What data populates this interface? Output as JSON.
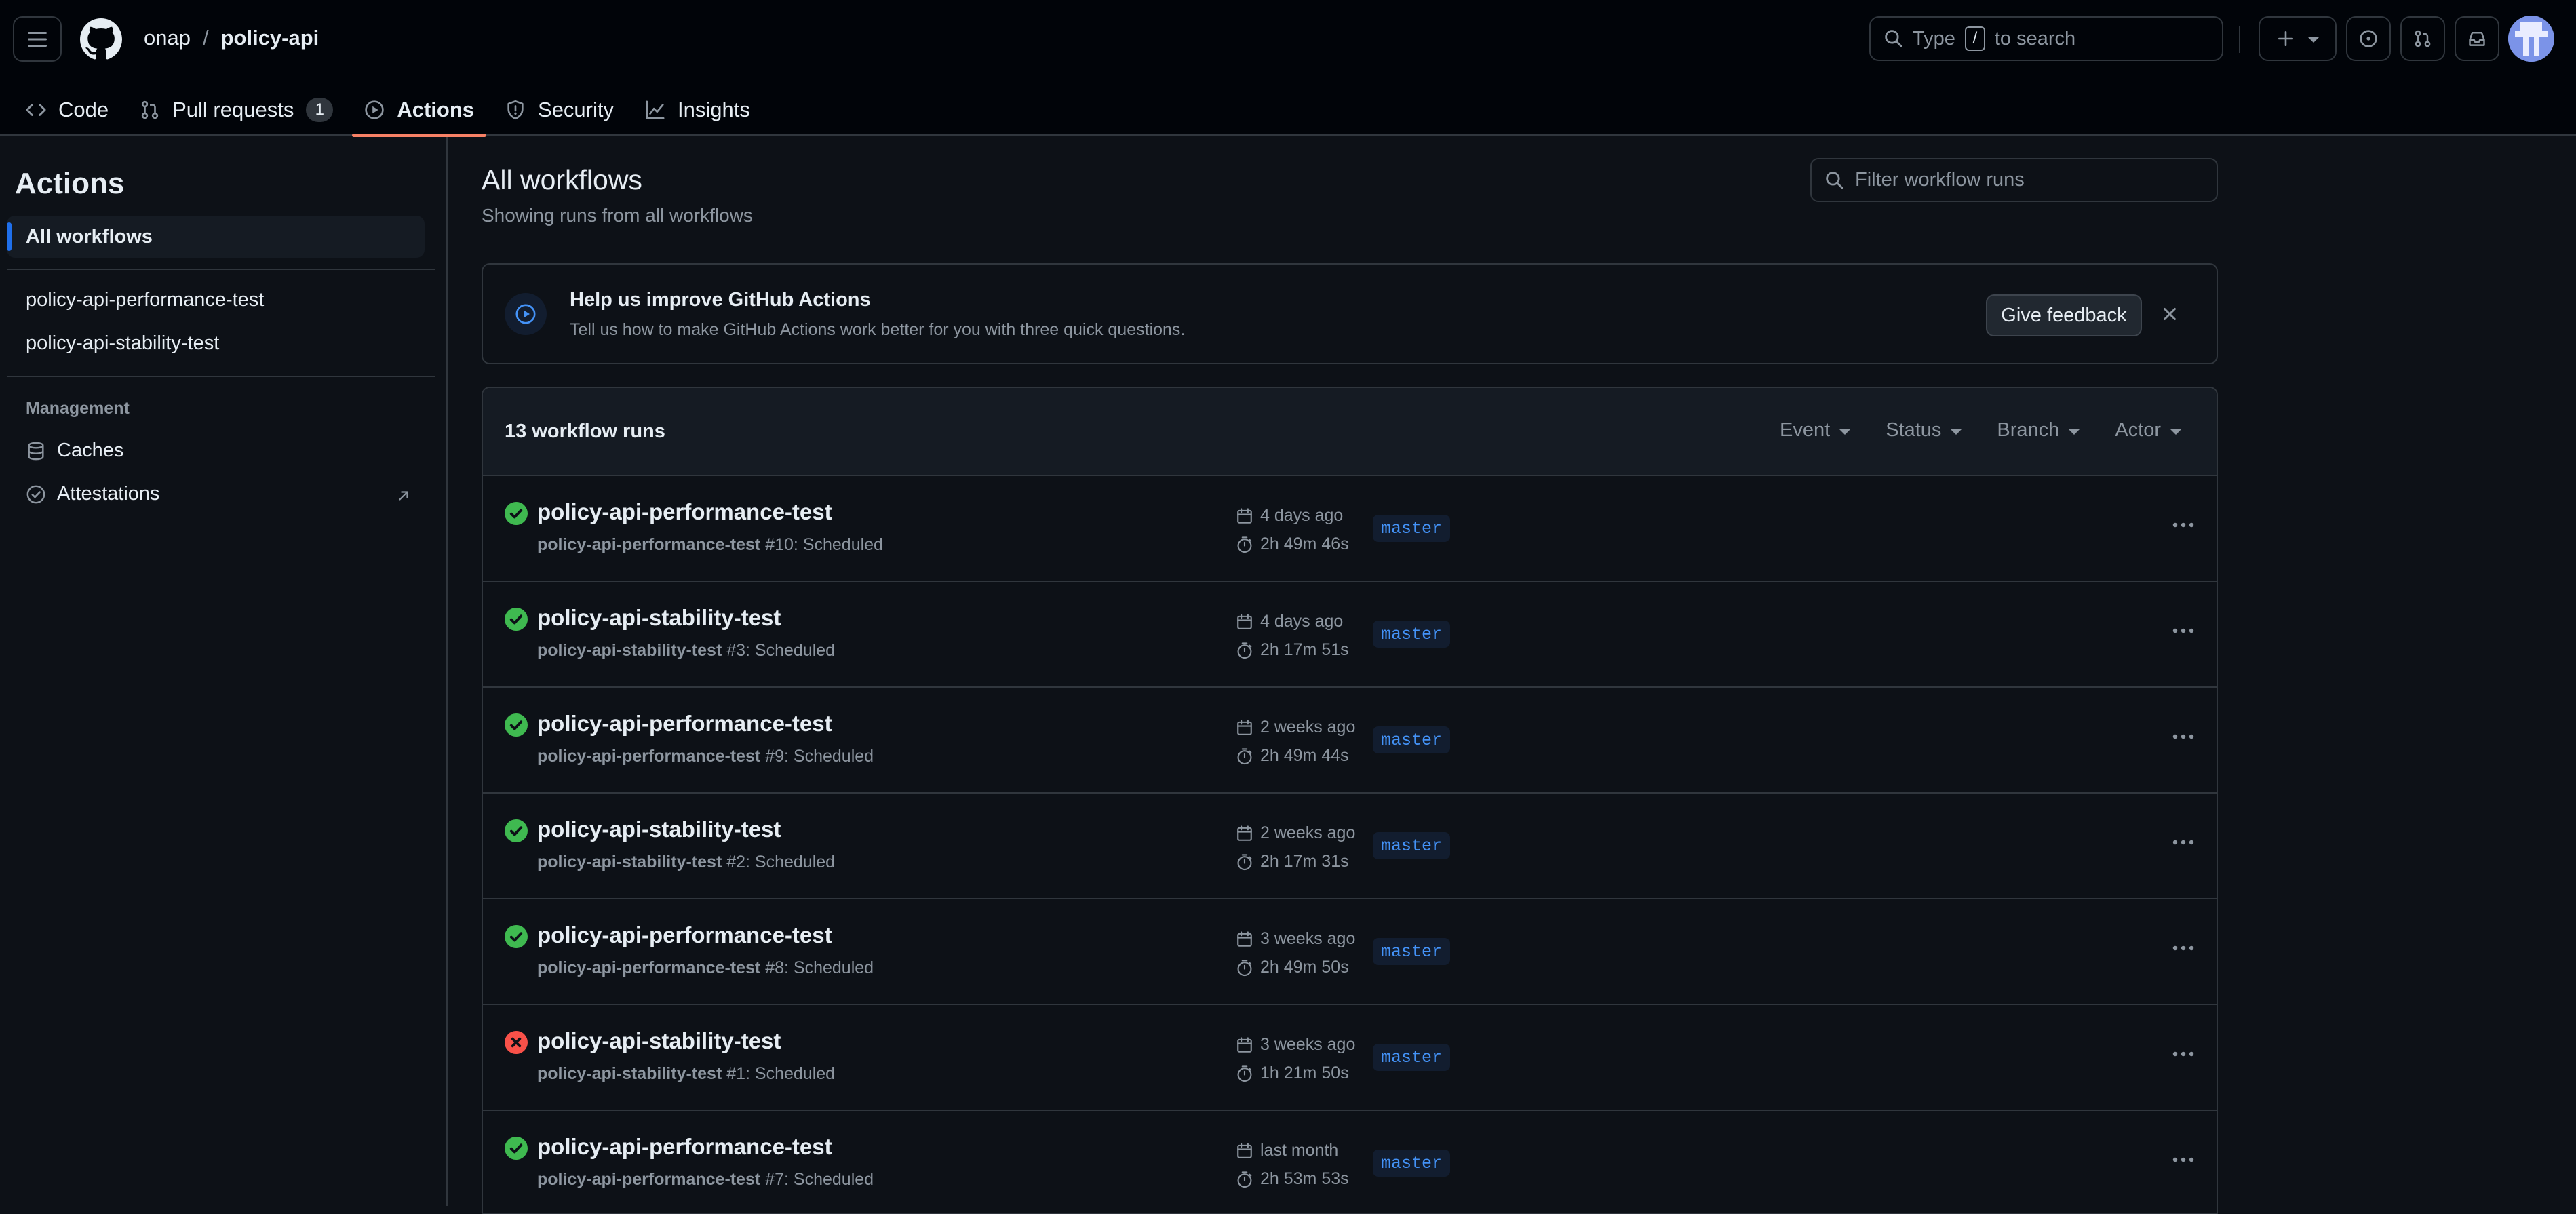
{
  "header": {
    "owner": "onap",
    "separator": "/",
    "repo": "policy-api",
    "search_prefix": "Type",
    "search_key": "/",
    "search_suffix": "to search"
  },
  "repo_nav": {
    "tabs": [
      {
        "label": "Code",
        "icon": "code-icon"
      },
      {
        "label": "Pull requests",
        "icon": "git-pull-request-icon",
        "count": "1"
      },
      {
        "label": "Actions",
        "icon": "play-icon",
        "active": true
      },
      {
        "label": "Security",
        "icon": "shield-icon"
      },
      {
        "label": "Insights",
        "icon": "graph-icon"
      }
    ]
  },
  "sidebar": {
    "title": "Actions",
    "all_workflows": "All workflows",
    "workflows": [
      "policy-api-performance-test",
      "policy-api-stability-test"
    ],
    "management_heading": "Management",
    "caches": "Caches",
    "attestations": "Attestations"
  },
  "main": {
    "title": "All workflows",
    "subtitle": "Showing runs from all workflows",
    "filter_placeholder": "Filter workflow runs"
  },
  "banner": {
    "title": "Help us improve GitHub Actions",
    "text": "Tell us how to make GitHub Actions work better for you with three quick questions.",
    "button": "Give feedback"
  },
  "runs": {
    "count_label": "13 workflow runs",
    "filters": [
      "Event",
      "Status",
      "Branch",
      "Actor"
    ],
    "items": [
      {
        "status": "success",
        "title": "policy-api-performance-test",
        "workflow": "policy-api-performance-test",
        "detail": "#10: Scheduled",
        "branch": "master",
        "when": "4 days ago",
        "duration": "2h 49m 46s"
      },
      {
        "status": "success",
        "title": "policy-api-stability-test",
        "workflow": "policy-api-stability-test",
        "detail": "#3: Scheduled",
        "branch": "master",
        "when": "4 days ago",
        "duration": "2h 17m 51s"
      },
      {
        "status": "success",
        "title": "policy-api-performance-test",
        "workflow": "policy-api-performance-test",
        "detail": "#9: Scheduled",
        "branch": "master",
        "when": "2 weeks ago",
        "duration": "2h 49m 44s"
      },
      {
        "status": "success",
        "title": "policy-api-stability-test",
        "workflow": "policy-api-stability-test",
        "detail": "#2: Scheduled",
        "branch": "master",
        "when": "2 weeks ago",
        "duration": "2h 17m 31s"
      },
      {
        "status": "success",
        "title": "policy-api-performance-test",
        "workflow": "policy-api-performance-test",
        "detail": "#8: Scheduled",
        "branch": "master",
        "when": "3 weeks ago",
        "duration": "2h 49m 50s"
      },
      {
        "status": "failure",
        "title": "policy-api-stability-test",
        "workflow": "policy-api-stability-test",
        "detail": "#1: Scheduled",
        "branch": "master",
        "when": "3 weeks ago",
        "duration": "1h 21m 50s"
      },
      {
        "status": "success",
        "title": "policy-api-performance-test",
        "workflow": "policy-api-performance-test",
        "detail": "#7: Scheduled",
        "branch": "master",
        "when": "last month",
        "duration": "2h 53m 53s"
      }
    ]
  },
  "colors": {
    "success": "#3fb950",
    "failure": "#f85149",
    "accent": "#1f6feb",
    "active_tab": "#f78166"
  }
}
